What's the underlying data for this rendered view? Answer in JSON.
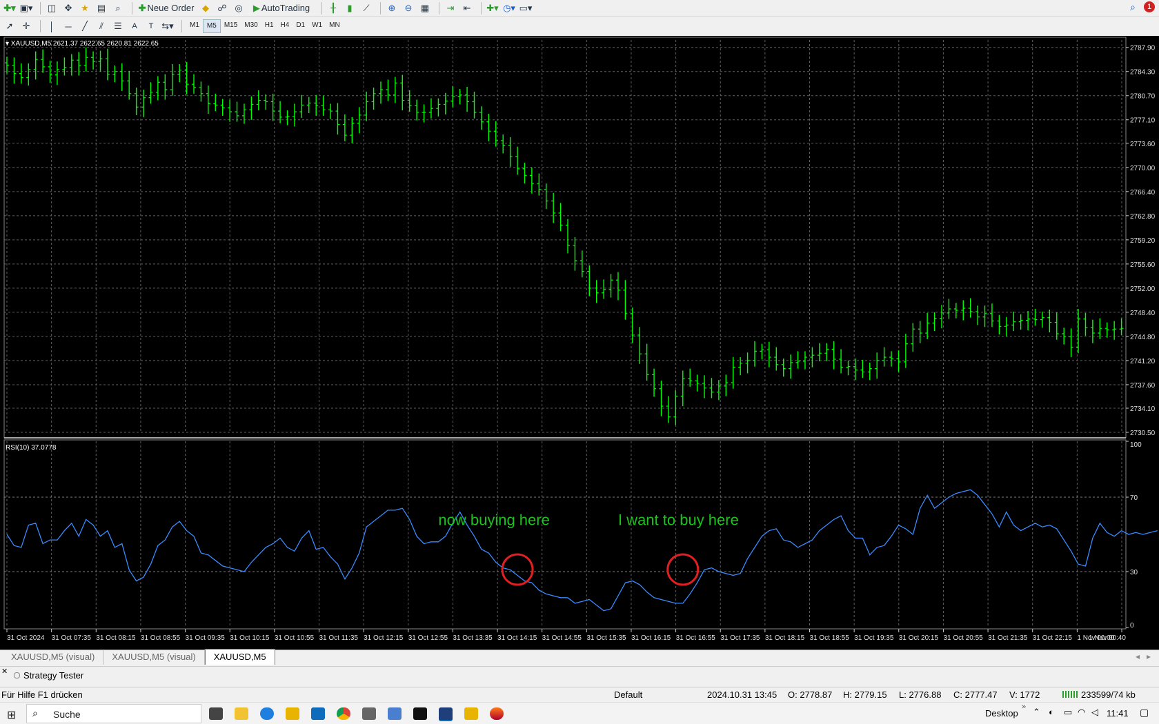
{
  "toolbar": {
    "new_order_label": "Neue Order",
    "autotrading_label": "AutoTrading",
    "timeframes": [
      "M1",
      "M5",
      "M15",
      "M30",
      "H1",
      "H4",
      "D1",
      "W1",
      "MN"
    ],
    "active_timeframe": "M5",
    "notification_count": "1"
  },
  "chart_data": [
    {
      "type": "bar",
      "title": "XAUUSD,M5  2621.37 2622.65 2620.81 2622.65",
      "ylim": [
        2730.5,
        2789.0
      ],
      "yticks": [
        "2787.90",
        "2784.30",
        "2780.70",
        "2777.10",
        "2773.60",
        "2770.00",
        "2766.40",
        "2762.80",
        "2759.20",
        "2755.60",
        "2752.00",
        "2748.40",
        "2744.80",
        "2741.20",
        "2737.60",
        "2734.10",
        "2730.50"
      ],
      "grid": true,
      "color": "#00ff00",
      "closes": [
        2785.2,
        2784.0,
        2783.4,
        2784.6,
        2786.1,
        2785.0,
        2783.8,
        2784.6,
        2784.9,
        2786.0,
        2785.2,
        2786.4,
        2785.8,
        2786.2,
        2783.9,
        2784.3,
        2782.9,
        2781.0,
        2779.0,
        2780.4,
        2781.2,
        2782.7,
        2781.6,
        2783.9,
        2784.5,
        2782.4,
        2781.9,
        2781.0,
        2779.5,
        2779.3,
        2778.9,
        2778.3,
        2777.7,
        2778.6,
        2779.4,
        2780.0,
        2779.8,
        2778.4,
        2777.5,
        2777.6,
        2778.3,
        2779.3,
        2779.6,
        2779.2,
        2778.6,
        2778.4,
        2776.4,
        2774.8,
        2776.6,
        2777.8,
        2779.8,
        2781.0,
        2781.6,
        2780.8,
        2782.6,
        2780.0,
        2779.2,
        2778.2,
        2778.2,
        2778.8,
        2779.4,
        2779.9,
        2780.6,
        2780.8,
        2779.8,
        2778.2,
        2776.8,
        2775.4,
        2774.0,
        2773.3,
        2771.6,
        2769.8,
        2768.8,
        2767.6,
        2766.7,
        2765.0,
        2763.2,
        2761.4,
        2758.4,
        2756.1,
        2754.5,
        2752.0,
        2751.3,
        2751.8,
        2753.2,
        2751.7,
        2748.2,
        2745.0,
        2742.2,
        2739.1,
        2737.0,
        2734.4,
        2732.8,
        2735.9,
        2738.5,
        2738.2,
        2737.8,
        2737.1,
        2736.5,
        2737.4,
        2737.9,
        2740.2,
        2740.8,
        2741.2,
        2742.6,
        2742.8,
        2741.7,
        2740.6,
        2740.0,
        2740.9,
        2741.1,
        2741.7,
        2742.0,
        2742.3,
        2742.9,
        2741.4,
        2740.2,
        2740.3,
        2739.8,
        2739.5,
        2740.0,
        2741.2,
        2741.7,
        2741.5,
        2741.0,
        2743.7,
        2745.9,
        2745.3,
        2746.8,
        2747.5,
        2748.3,
        2748.9,
        2748.7,
        2749.0,
        2748.5,
        2747.7,
        2748.2,
        2747.1,
        2746.3,
        2746.5,
        2747.0,
        2747.2,
        2747.4,
        2747.3,
        2747.6,
        2746.9,
        2745.2,
        2744.8,
        2743.2,
        2747.4,
        2746.1,
        2745.3,
        2746.0,
        2745.8,
        2745.9,
        2746.0
      ]
    },
    {
      "type": "line",
      "title": "RSI(10) 37.0778",
      "ylim": [
        0,
        100
      ],
      "yticks": [
        "100",
        "70",
        "30",
        "0"
      ],
      "levels": [
        70,
        30
      ],
      "grid": true,
      "color": "#3a8bff",
      "series": [
        {
          "name": "RSI(10)",
          "values": [
            50,
            44,
            43,
            55,
            56,
            45,
            47,
            47,
            52,
            56,
            49,
            58,
            55,
            49,
            52,
            43,
            45,
            31,
            25,
            27,
            34,
            44,
            47,
            54,
            57,
            52,
            49,
            40,
            39,
            36,
            33,
            32,
            31,
            30,
            35,
            39,
            43,
            45,
            48,
            43,
            41,
            48,
            52,
            42,
            43,
            38,
            34,
            26,
            32,
            40,
            54,
            57,
            60,
            63,
            63,
            64,
            58,
            49,
            45,
            46,
            46,
            49,
            56,
            62,
            55,
            49,
            42,
            40,
            35,
            32,
            31,
            28,
            25,
            24,
            20,
            18,
            17,
            16,
            16,
            13,
            14,
            15,
            12,
            9,
            10,
            17,
            24,
            25,
            23,
            19,
            16,
            15,
            14,
            13,
            13,
            18,
            24,
            31,
            32,
            30,
            29,
            28,
            29,
            37,
            43,
            49,
            52,
            53,
            47,
            46,
            43,
            45,
            47,
            52,
            55,
            58,
            60,
            52,
            48,
            48,
            39,
            43,
            44,
            49,
            55,
            53,
            50,
            64,
            71,
            64,
            67,
            70,
            72,
            73,
            74,
            71,
            66,
            61,
            54,
            62,
            55,
            52,
            54,
            56,
            54,
            55,
            53,
            47,
            41,
            34,
            33,
            48,
            56,
            51,
            49,
            52,
            50,
            51,
            50,
            51,
            52
          ]
        }
      ],
      "annotations": [
        "now buying here",
        "I want to buy here"
      ]
    }
  ],
  "time_axis": [
    "31 Oct 2024",
    "31 Oct 07:35",
    "31 Oct 08:15",
    "31 Oct 08:55",
    "31 Oct 09:35",
    "31 Oct 10:15",
    "31 Oct 10:55",
    "31 Oct 11:35",
    "31 Oct 12:15",
    "31 Oct 12:55",
    "31 Oct 13:35",
    "31 Oct 14:15",
    "31 Oct 14:55",
    "31 Oct 15:35",
    "31 Oct 16:15",
    "31 Oct 16:55",
    "31 Oct 17:35",
    "31 Oct 18:15",
    "31 Oct 18:55",
    "31 Oct 19:35",
    "31 Oct 20:15",
    "31 Oct 20:55",
    "31 Oct 21:35",
    "31 Oct 22:15",
    "1 Nov 00:00",
    "1 Nov 00:40"
  ],
  "tabs": [
    "XAUUSD,M5 (visual)",
    "XAUUSD,M5 (visual)",
    "XAUUSD,M5"
  ],
  "active_tab": "XAUUSD,M5",
  "tester_label": "Strategy Tester",
  "status": {
    "help": "Für Hilfe F1 drücken",
    "profile": "Default",
    "datetime": "2024.10.31 13:45",
    "open": "O: 2778.87",
    "high": "H: 2779.15",
    "low": "L: 2776.88",
    "close": "C: 2777.47",
    "volume": "V: 1772",
    "traffic": "233599/74 kb"
  },
  "taskbar": {
    "search_placeholder": "Suche",
    "desktop_label": "Desktop",
    "clock": "11:41"
  }
}
